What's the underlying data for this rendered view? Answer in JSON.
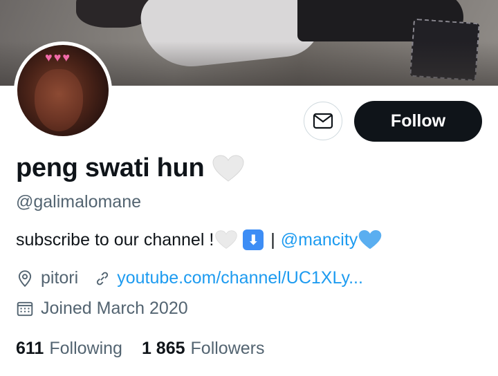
{
  "profile": {
    "display_name": "peng swati hun",
    "name_emoji": "white-heart",
    "handle": "@galimalomane",
    "bio": {
      "text": "subscribe to our channel !",
      "emoji_1": "white-heart",
      "emoji_2": "down-arrow",
      "separator": "|",
      "mention": "@mancity",
      "emoji_3": "blue-heart"
    },
    "location": "pitori",
    "website": "youtube.com/channel/UC1XLy...",
    "joined": "Joined March 2020",
    "following_count": "611",
    "following_label": "Following",
    "followers_count": "1 865",
    "followers_label": "Followers"
  },
  "actions": {
    "message_icon": "envelope-icon",
    "follow_label": "Follow"
  },
  "colors": {
    "accent": "#1d9bf0",
    "text": "#0f1419",
    "muted": "#536471",
    "follow_bg": "#0f1419"
  }
}
